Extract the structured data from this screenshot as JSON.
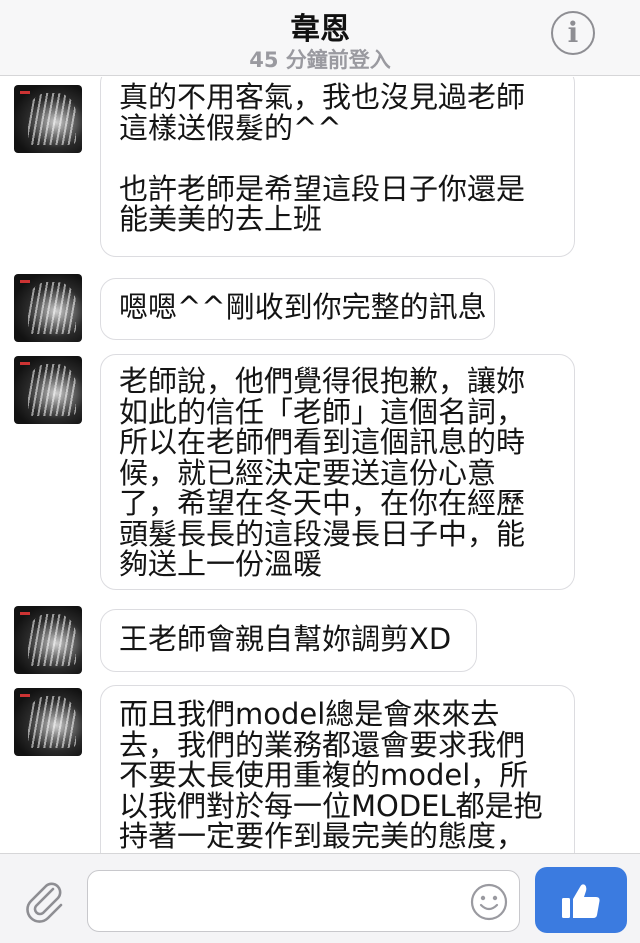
{
  "header": {
    "contact_name": "韋恩",
    "status": "45 分鐘前登入",
    "info_icon": "info-icon",
    "info_glyph": "i"
  },
  "messages": [
    {
      "lines": [
        "真的不用客氣，我也沒見過老師",
        "這樣送假髮的^^",
        "",
        "也許老師是希望這段日子你還是",
        "能美美的去上班"
      ]
    },
    {
      "lines": [
        "嗯嗯^^剛收到你完整的訊息"
      ]
    },
    {
      "lines": [
        "老師說，他們覺得很抱歉，讓妳",
        "如此的信任「老師」這個名詞，",
        "所以在老師們看到這個訊息的時",
        "候，就已經決定要送這份心意",
        "了，希望在冬天中，在你在經歷",
        "頭髮長長的這段漫長日子中，能",
        "夠送上一份溫暖"
      ]
    },
    {
      "lines": [
        "王老師會親自幫妳調剪XD"
      ]
    },
    {
      "lines": [
        "而且我們model總是會來來去",
        "去，我們的業務都還會要求我們",
        "不要太長使用重複的model，所",
        "以我們對於每一位MODEL都是抱",
        "持著一定要作到最完美的態度，"
      ]
    }
  ],
  "composer": {
    "input_value": "",
    "input_placeholder": "",
    "attach_icon": "paperclip-icon",
    "emoji_icon": "smiley-icon",
    "send_icon": "thumbs-up-icon",
    "accent_color": "#3b7be0"
  }
}
